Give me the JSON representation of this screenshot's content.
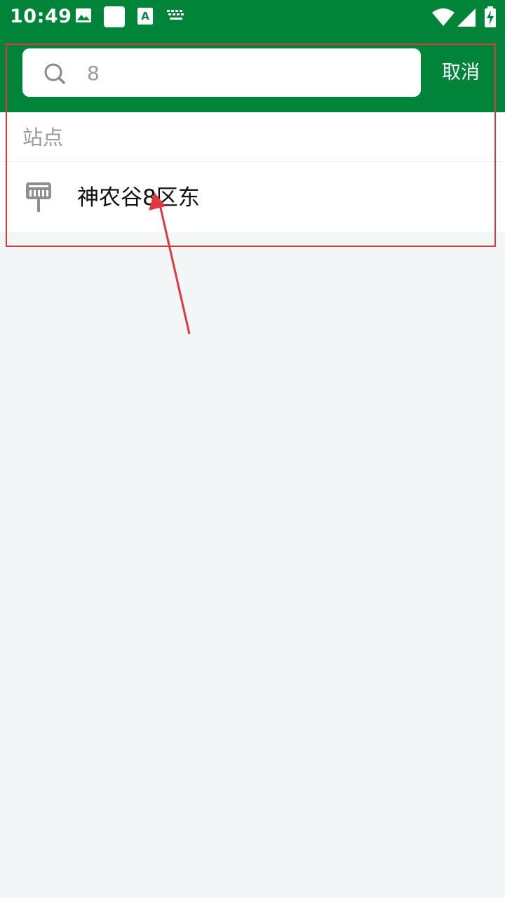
{
  "status_bar": {
    "time": "10:49",
    "left_icons": [
      "image-icon",
      "blank-square-icon",
      "text-a-icon",
      "keyboard-icon"
    ],
    "right_icons": [
      "wifi-icon",
      "signal-icon",
      "battery-charging-icon"
    ]
  },
  "search": {
    "value": "8",
    "cancel_label": "取消"
  },
  "results": {
    "section_title": "站点",
    "items": [
      {
        "name": "神农谷8区东",
        "icon": "bus-stop-icon"
      }
    ]
  },
  "colors": {
    "brand_green": "#00843a",
    "background": "#f3f6f7",
    "annotation_red": "#e0383e"
  }
}
